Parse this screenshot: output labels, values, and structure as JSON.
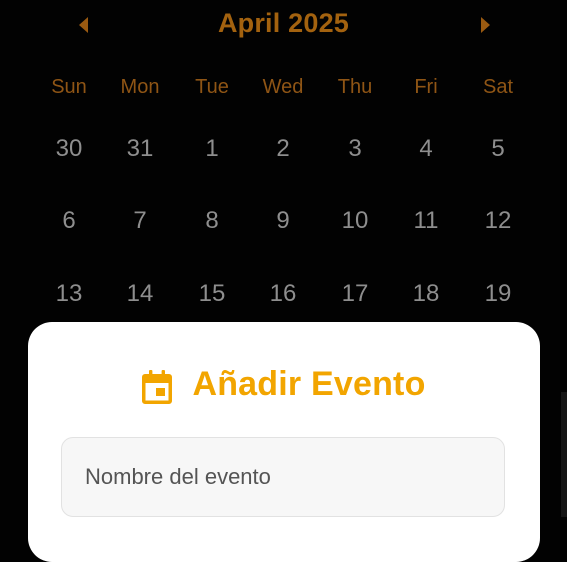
{
  "calendar": {
    "month_title": "April 2025",
    "prev_icon": "chevron-left-icon",
    "next_icon": "chevron-right-icon",
    "weekdays": [
      "Sun",
      "Mon",
      "Tue",
      "Wed",
      "Thu",
      "Fri",
      "Sat"
    ],
    "weeks": [
      [
        "30",
        "31",
        "1",
        "2",
        "3",
        "4",
        "5"
      ],
      [
        "6",
        "7",
        "8",
        "9",
        "10",
        "11",
        "12"
      ],
      [
        "13",
        "14",
        "15",
        "16",
        "17",
        "18",
        "19"
      ]
    ]
  },
  "add_event_sheet": {
    "icon": "calendar-icon",
    "title": "Añadir Evento",
    "name_field": {
      "placeholder": "Nombre del evento",
      "value": ""
    }
  },
  "colors": {
    "background": "#020202",
    "header_accent": "#a3620f",
    "weekday_label": "#8f5515",
    "day_number": "#8e8e8e",
    "sheet_background": "#ffffff",
    "sheet_accent": "#f2a500",
    "input_background": "#f7f7f7"
  }
}
